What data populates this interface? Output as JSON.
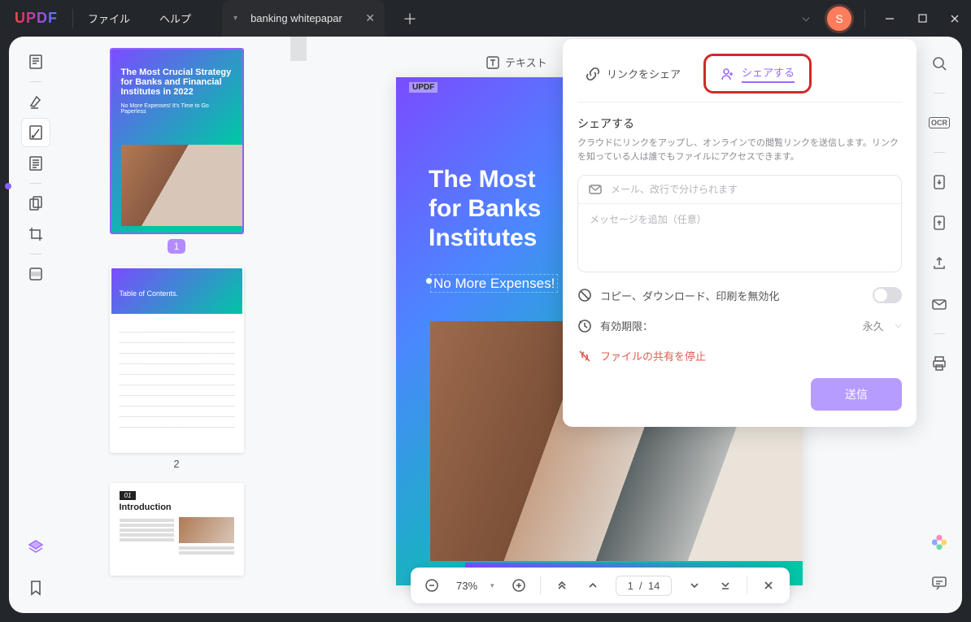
{
  "titlebar": {
    "logo": "UPDF",
    "menu_file": "ファイル",
    "menu_help": "ヘルプ",
    "tab_title": "banking whitepapar",
    "avatar_letter": "S"
  },
  "left_tools": {
    "reader": "reader-icon",
    "comment": "comment-icon",
    "edit": "edit-icon",
    "page": "page-icon",
    "tools": "tools-icon",
    "crop": "crop-icon",
    "redact": "redact-icon"
  },
  "thumbnails": {
    "p1": {
      "num": "1",
      "title": "The Most Crucial Strategy for Banks and Financial Institutes in 2022",
      "sub": "No More Expenses! It's Time to Go Paperless"
    },
    "p2": {
      "num": "2",
      "title": "Table of Contents."
    },
    "p3": {
      "chip": "01",
      "title": "Introduction"
    }
  },
  "doc": {
    "brand": "UPDF",
    "title_l1": "The Most",
    "title_l2": "for Banks",
    "title_l3": "Institutes",
    "subtitle": "No More Expenses!",
    "text_tool_label": "テキスト"
  },
  "bottom": {
    "zoom": "73%",
    "page_current": "1",
    "page_sep": "/",
    "page_total": "14"
  },
  "share": {
    "tab_link": "リンクをシェア",
    "tab_share": "シェアする",
    "heading": "シェアする",
    "desc": "クラウドにリンクをアップし、オンラインでの閲覧リンクを送信します。リンクを知っている人は誰でもファイルにアクセスできます。",
    "email_placeholder": "メール、改行で分けられます",
    "message_placeholder": "メッセージを追加（任意）",
    "opt_disable": "コピー、ダウンロード、印刷を無効化",
    "opt_expiry_label": "有効期限：",
    "opt_expiry_value": "永久",
    "opt_stop": "ファイルの共有を停止",
    "send": "送信"
  },
  "right_tools": {
    "ocr": "OCR"
  }
}
